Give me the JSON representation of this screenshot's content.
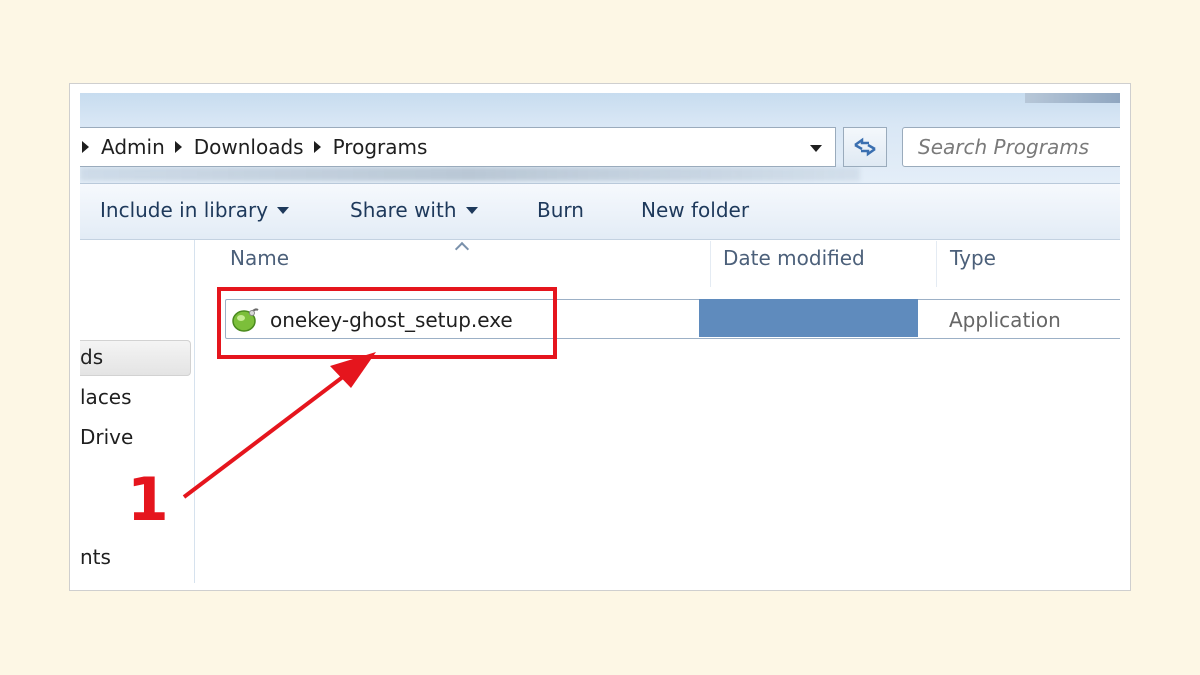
{
  "address_bar": {
    "breadcrumbs": [
      "Admin",
      "Downloads",
      "Programs"
    ],
    "search_placeholder": "Search Programs"
  },
  "toolbar": {
    "include_in_library": "Include in library",
    "share_with": "Share with",
    "burn": "Burn",
    "new_folder": "New folder"
  },
  "nav_pane": {
    "items": [
      "ds",
      "laces",
      "Drive",
      "nts"
    ]
  },
  "columns": {
    "name": "Name",
    "date_modified": "Date modified",
    "type": "Type"
  },
  "files": [
    {
      "name": "onekey-ghost_setup.exe",
      "type": "Application"
    }
  ],
  "annotation": {
    "step_number": "1",
    "color": "#e5151d"
  },
  "colors": {
    "background": "#fdf7e5",
    "toolbar_text": "#1e395b",
    "redaction": "#5f8bbd"
  }
}
